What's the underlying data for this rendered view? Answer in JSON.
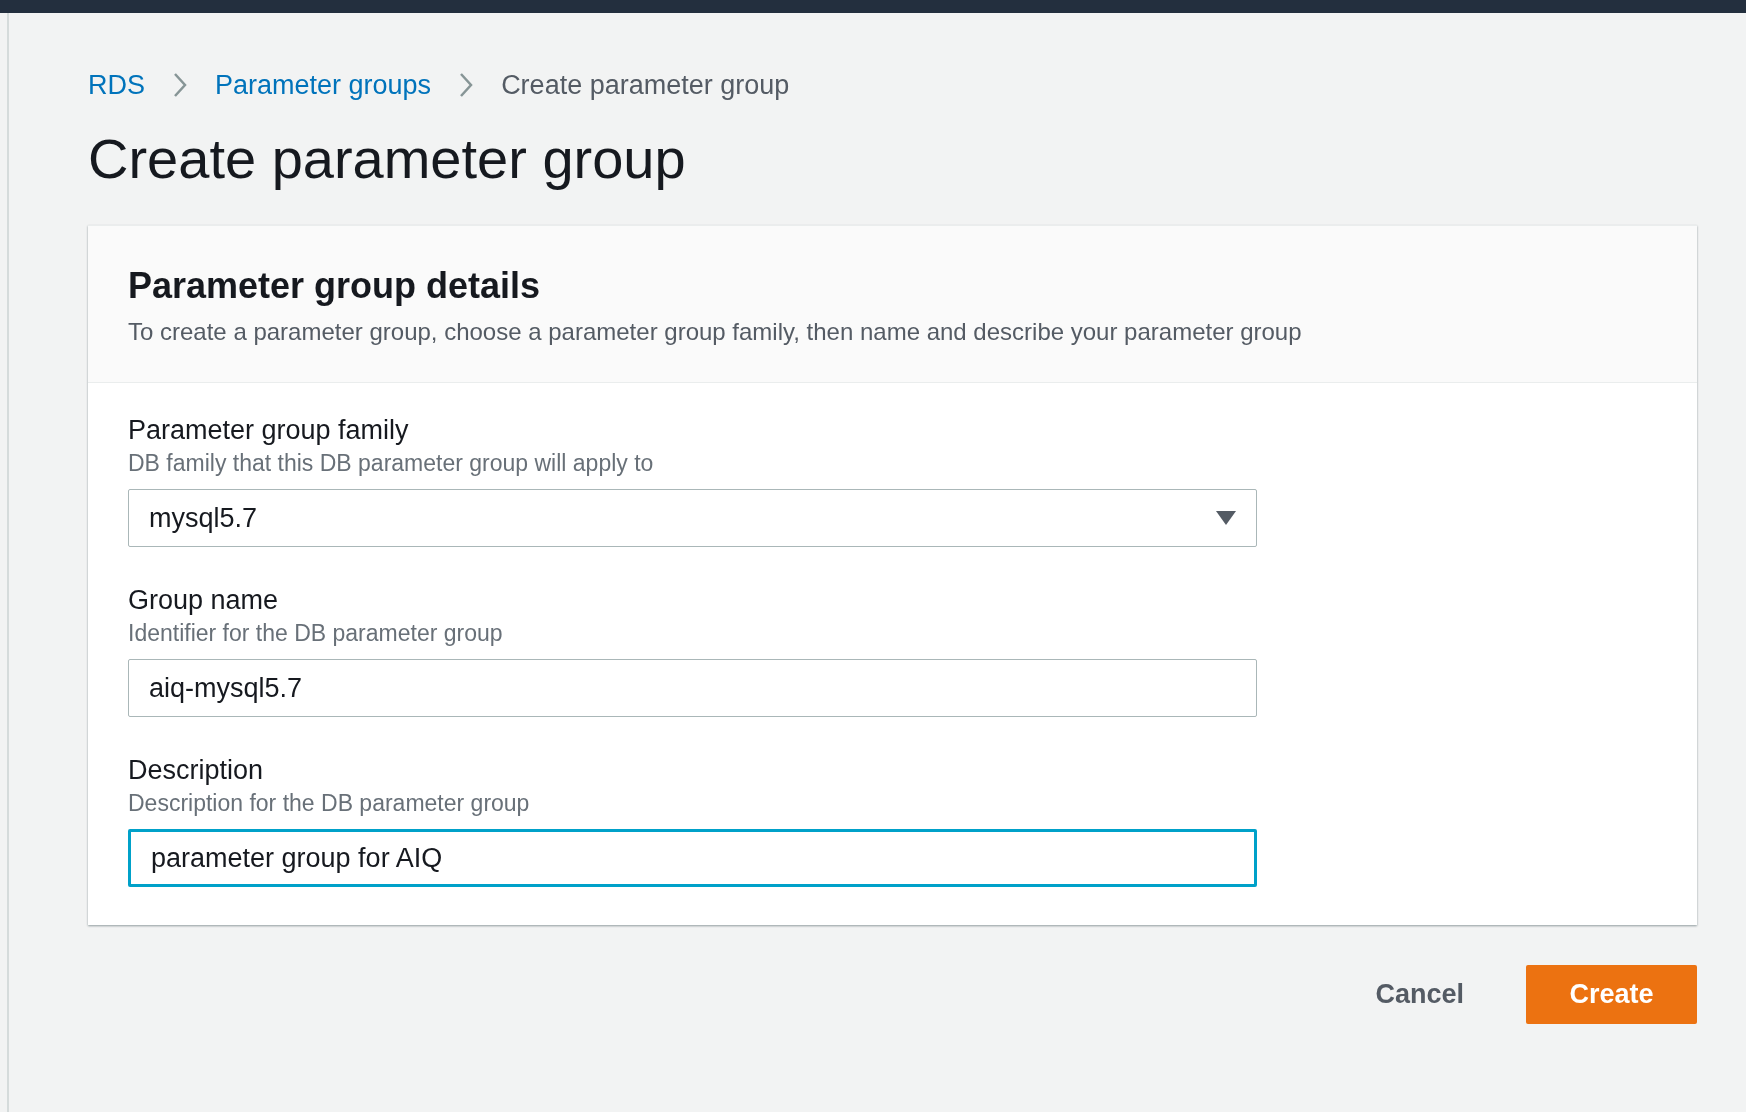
{
  "breadcrumbs": [
    {
      "label": "RDS",
      "kind": "link"
    },
    {
      "label": "Parameter groups",
      "kind": "link"
    },
    {
      "label": "Create parameter group",
      "kind": "current"
    }
  ],
  "title": "Create parameter group",
  "panel": {
    "title": "Parameter group details",
    "description": "To create a parameter group, choose a parameter group family, then name and describe your parameter group",
    "fields": [
      {
        "kind": "select",
        "label": "Parameter group family",
        "hint": "DB family that this DB parameter group will apply to",
        "value": "mysql5.7",
        "focused": false
      },
      {
        "kind": "text",
        "label": "Group name",
        "hint": "Identifier for the DB parameter group",
        "value": "aiq-mysql5.7",
        "focused": false
      },
      {
        "kind": "text",
        "label": "Description",
        "hint": "Description for the DB parameter group",
        "value": "parameter group for AIQ",
        "focused": true
      }
    ]
  },
  "buttons": [
    {
      "label": "Cancel",
      "kind": "link"
    },
    {
      "label": "Create",
      "kind": "primary"
    }
  ]
}
